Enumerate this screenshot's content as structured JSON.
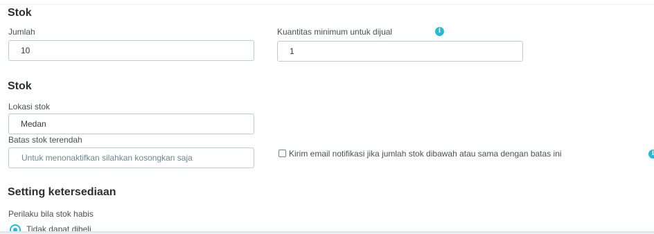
{
  "stock_section": {
    "title": "Stok",
    "quantity_label": "Jumlah",
    "quantity_value": "10",
    "min_quantity_label": "Kuantitas minimum untuk dijual",
    "min_quantity_value": "1"
  },
  "stock_location_section": {
    "title": "Stok",
    "location_label": "Lokasi stok",
    "location_value": "Medan",
    "low_stock_label": "Batas stok terendah",
    "low_stock_placeholder": "Untuk menonaktifkan silahkan kosongkan saja",
    "low_stock_email_label": "Kirim email notifikasi jika jumlah stok dibawah atau sama dengan batas ini",
    "low_stock_email_checked": false
  },
  "availability_section": {
    "title": "Setting ketersediaan",
    "out_of_stock_label": "Perilaku bila stok habis",
    "options": [
      {
        "label": "Tidak dapat dibeli",
        "selected": true
      }
    ]
  },
  "colors": {
    "accent": "#25b9d7",
    "input_border": "#bbcdd2"
  },
  "icons": {
    "info": "info-icon",
    "checkbox": "checkbox-icon",
    "radio": "radio-selected-icon"
  }
}
